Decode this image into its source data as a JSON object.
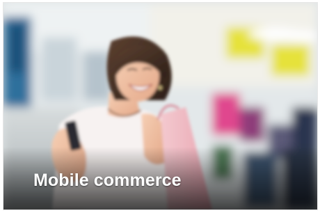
{
  "banner": {
    "caption": "Mobile commerce",
    "caption_color": "#ffffff",
    "sign_color": "#e6e23a"
  }
}
